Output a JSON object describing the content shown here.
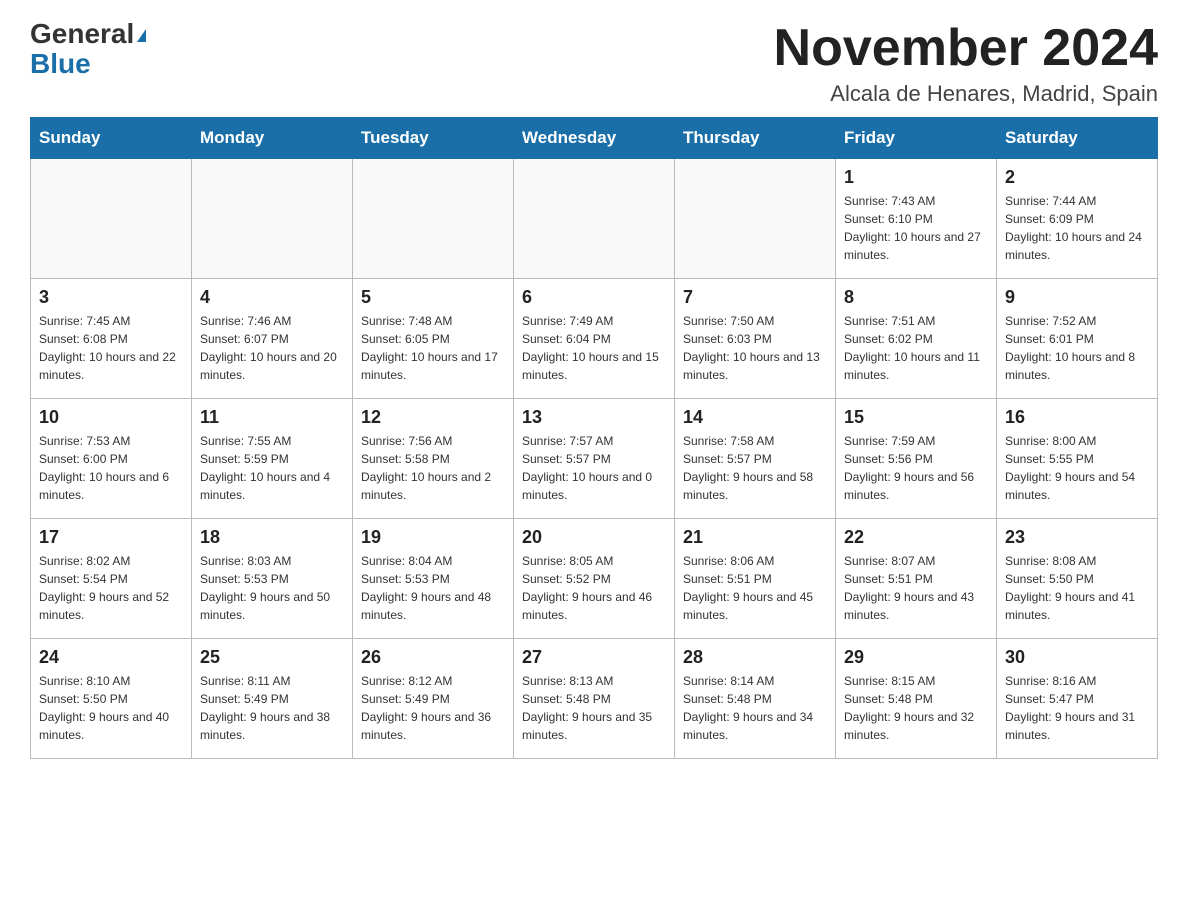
{
  "header": {
    "logo_line1": "General",
    "logo_line2": "Blue",
    "title": "November 2024",
    "subtitle": "Alcala de Henares, Madrid, Spain"
  },
  "weekdays": [
    "Sunday",
    "Monday",
    "Tuesday",
    "Wednesday",
    "Thursday",
    "Friday",
    "Saturday"
  ],
  "weeks": [
    [
      {
        "day": "",
        "info": ""
      },
      {
        "day": "",
        "info": ""
      },
      {
        "day": "",
        "info": ""
      },
      {
        "day": "",
        "info": ""
      },
      {
        "day": "",
        "info": ""
      },
      {
        "day": "1",
        "info": "Sunrise: 7:43 AM\nSunset: 6:10 PM\nDaylight: 10 hours and 27 minutes."
      },
      {
        "day": "2",
        "info": "Sunrise: 7:44 AM\nSunset: 6:09 PM\nDaylight: 10 hours and 24 minutes."
      }
    ],
    [
      {
        "day": "3",
        "info": "Sunrise: 7:45 AM\nSunset: 6:08 PM\nDaylight: 10 hours and 22 minutes."
      },
      {
        "day": "4",
        "info": "Sunrise: 7:46 AM\nSunset: 6:07 PM\nDaylight: 10 hours and 20 minutes."
      },
      {
        "day": "5",
        "info": "Sunrise: 7:48 AM\nSunset: 6:05 PM\nDaylight: 10 hours and 17 minutes."
      },
      {
        "day": "6",
        "info": "Sunrise: 7:49 AM\nSunset: 6:04 PM\nDaylight: 10 hours and 15 minutes."
      },
      {
        "day": "7",
        "info": "Sunrise: 7:50 AM\nSunset: 6:03 PM\nDaylight: 10 hours and 13 minutes."
      },
      {
        "day": "8",
        "info": "Sunrise: 7:51 AM\nSunset: 6:02 PM\nDaylight: 10 hours and 11 minutes."
      },
      {
        "day": "9",
        "info": "Sunrise: 7:52 AM\nSunset: 6:01 PM\nDaylight: 10 hours and 8 minutes."
      }
    ],
    [
      {
        "day": "10",
        "info": "Sunrise: 7:53 AM\nSunset: 6:00 PM\nDaylight: 10 hours and 6 minutes."
      },
      {
        "day": "11",
        "info": "Sunrise: 7:55 AM\nSunset: 5:59 PM\nDaylight: 10 hours and 4 minutes."
      },
      {
        "day": "12",
        "info": "Sunrise: 7:56 AM\nSunset: 5:58 PM\nDaylight: 10 hours and 2 minutes."
      },
      {
        "day": "13",
        "info": "Sunrise: 7:57 AM\nSunset: 5:57 PM\nDaylight: 10 hours and 0 minutes."
      },
      {
        "day": "14",
        "info": "Sunrise: 7:58 AM\nSunset: 5:57 PM\nDaylight: 9 hours and 58 minutes."
      },
      {
        "day": "15",
        "info": "Sunrise: 7:59 AM\nSunset: 5:56 PM\nDaylight: 9 hours and 56 minutes."
      },
      {
        "day": "16",
        "info": "Sunrise: 8:00 AM\nSunset: 5:55 PM\nDaylight: 9 hours and 54 minutes."
      }
    ],
    [
      {
        "day": "17",
        "info": "Sunrise: 8:02 AM\nSunset: 5:54 PM\nDaylight: 9 hours and 52 minutes."
      },
      {
        "day": "18",
        "info": "Sunrise: 8:03 AM\nSunset: 5:53 PM\nDaylight: 9 hours and 50 minutes."
      },
      {
        "day": "19",
        "info": "Sunrise: 8:04 AM\nSunset: 5:53 PM\nDaylight: 9 hours and 48 minutes."
      },
      {
        "day": "20",
        "info": "Sunrise: 8:05 AM\nSunset: 5:52 PM\nDaylight: 9 hours and 46 minutes."
      },
      {
        "day": "21",
        "info": "Sunrise: 8:06 AM\nSunset: 5:51 PM\nDaylight: 9 hours and 45 minutes."
      },
      {
        "day": "22",
        "info": "Sunrise: 8:07 AM\nSunset: 5:51 PM\nDaylight: 9 hours and 43 minutes."
      },
      {
        "day": "23",
        "info": "Sunrise: 8:08 AM\nSunset: 5:50 PM\nDaylight: 9 hours and 41 minutes."
      }
    ],
    [
      {
        "day": "24",
        "info": "Sunrise: 8:10 AM\nSunset: 5:50 PM\nDaylight: 9 hours and 40 minutes."
      },
      {
        "day": "25",
        "info": "Sunrise: 8:11 AM\nSunset: 5:49 PM\nDaylight: 9 hours and 38 minutes."
      },
      {
        "day": "26",
        "info": "Sunrise: 8:12 AM\nSunset: 5:49 PM\nDaylight: 9 hours and 36 minutes."
      },
      {
        "day": "27",
        "info": "Sunrise: 8:13 AM\nSunset: 5:48 PM\nDaylight: 9 hours and 35 minutes."
      },
      {
        "day": "28",
        "info": "Sunrise: 8:14 AM\nSunset: 5:48 PM\nDaylight: 9 hours and 34 minutes."
      },
      {
        "day": "29",
        "info": "Sunrise: 8:15 AM\nSunset: 5:48 PM\nDaylight: 9 hours and 32 minutes."
      },
      {
        "day": "30",
        "info": "Sunrise: 8:16 AM\nSunset: 5:47 PM\nDaylight: 9 hours and 31 minutes."
      }
    ]
  ]
}
